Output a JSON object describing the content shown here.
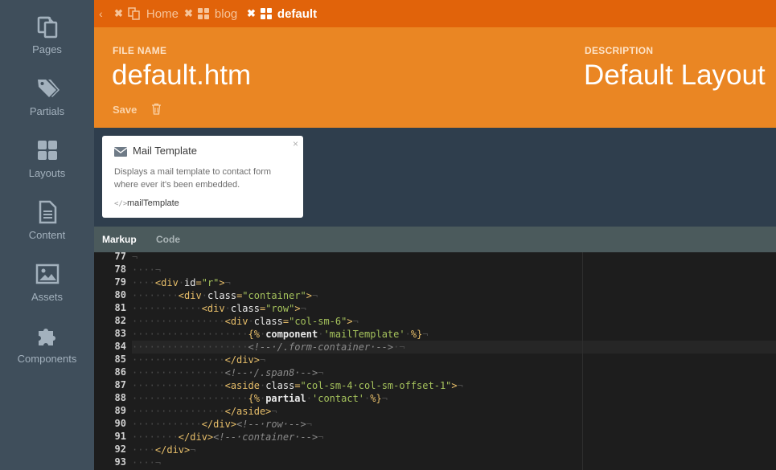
{
  "sidebar": {
    "items": [
      {
        "label": "Pages",
        "icon": "pages-icon"
      },
      {
        "label": "Partials",
        "icon": "tags-icon"
      },
      {
        "label": "Layouts",
        "icon": "grid-icon"
      },
      {
        "label": "Content",
        "icon": "document-icon"
      },
      {
        "label": "Assets",
        "icon": "image-icon"
      },
      {
        "label": "Components",
        "icon": "puzzle-icon"
      }
    ]
  },
  "tabs": {
    "back": "‹",
    "items": [
      {
        "label": "Home"
      },
      {
        "label": "blog"
      },
      {
        "label": "default"
      }
    ]
  },
  "header": {
    "file_name_label": "FILE NAME",
    "file_name_value": "default.htm",
    "description_label": "DESCRIPTION",
    "description_value": "Default Layout",
    "save_label": "Save"
  },
  "component": {
    "title": "Mail Template",
    "description": "Displays a mail template to contact form where ever it's been embedded.",
    "alias": "mailTemplate",
    "alias_icon": "</>",
    "close": "×"
  },
  "subtabs": [
    {
      "label": "Markup",
      "active": true
    },
    {
      "label": "Code",
      "active": false
    }
  ],
  "editor": {
    "line_numbers": [
      "77",
      "78",
      "79",
      "80",
      "81",
      "82",
      "83",
      "84",
      "85",
      "86",
      "87",
      "88",
      "89",
      "90",
      "91",
      "92",
      "93"
    ],
    "active_line": "84"
  },
  "colors": {
    "tabbar": "#e1630a",
    "header": "#ea8623",
    "sidebar": "#3f4e5b",
    "editor_bg": "#1d1d1d"
  }
}
